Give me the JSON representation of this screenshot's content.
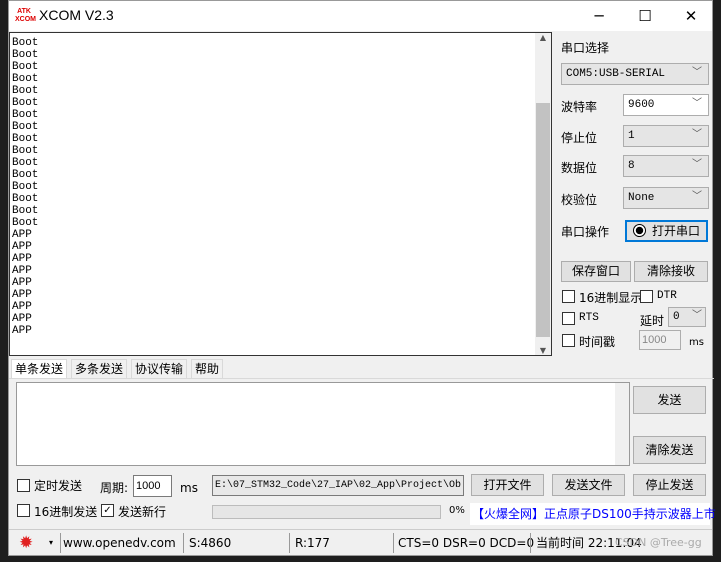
{
  "window": {
    "title": "XCOM V2.3",
    "logo": "ATK XCOM",
    "minimize": "─",
    "maximize": "☐",
    "close": "✕"
  },
  "receive": {
    "lines": [
      "Boot",
      "Boot",
      "Boot",
      "Boot",
      "Boot",
      "Boot",
      "Boot",
      "Boot",
      "Boot",
      "Boot",
      "Boot",
      "Boot",
      "Boot",
      "Boot",
      "Boot",
      "Boot",
      "APP",
      "APP",
      "APP",
      "APP",
      "APP",
      "APP",
      "APP",
      "APP",
      "APP"
    ]
  },
  "panel": {
    "port_label": "串口选择",
    "port_value": "COM5:USB-SERIAL",
    "baud_label": "波特率",
    "baud_value": "9600",
    "stop_label": "停止位",
    "stop_value": "1",
    "data_label": "数据位",
    "data_value": "8",
    "parity_label": "校验位",
    "parity_value": "None",
    "op_label": "串口操作",
    "open_button": "打开串口",
    "save_button": "保存窗口",
    "clear_recv_button": "清除接收",
    "hex_display": "16进制显示",
    "dtr": "DTR",
    "rts": "RTS",
    "delay_label": "延时",
    "delay_value": "0",
    "timestamp": "时间戳",
    "timestamp_value": "1000",
    "ms": "ms"
  },
  "tabs": [
    "单条发送",
    "多条发送",
    "协议传输",
    "帮助"
  ],
  "send": {
    "send_button": "发送",
    "clear_send_button": "清除发送",
    "timed_send": "定时发送",
    "period_label": "周期:",
    "period_value": "1000",
    "ms": "ms",
    "file_path": "E:\\07_STM32_Code\\27_IAP\\02_App\\Project\\Ob",
    "open_file": "打开文件",
    "send_file": "发送文件",
    "stop_send": "停止发送",
    "hex_send": "16进制发送",
    "newline": "发送新行",
    "newline_checked": true,
    "progress": "0%",
    "progress_value": 0,
    "ad": "【火爆全网】正点原子DS100手持示波器上市"
  },
  "status": {
    "url": "www.openedv.com",
    "sent": "S:4860",
    "recv": "R:177",
    "lines": "CTS=0 DSR=0 DCD=0",
    "time": "当前时间 22:11:04",
    "watermark": "CSDN @Tree-gg"
  },
  "colors": {
    "accent": "#0078d7",
    "ad": "#0000ff",
    "gear": "#e02020"
  }
}
